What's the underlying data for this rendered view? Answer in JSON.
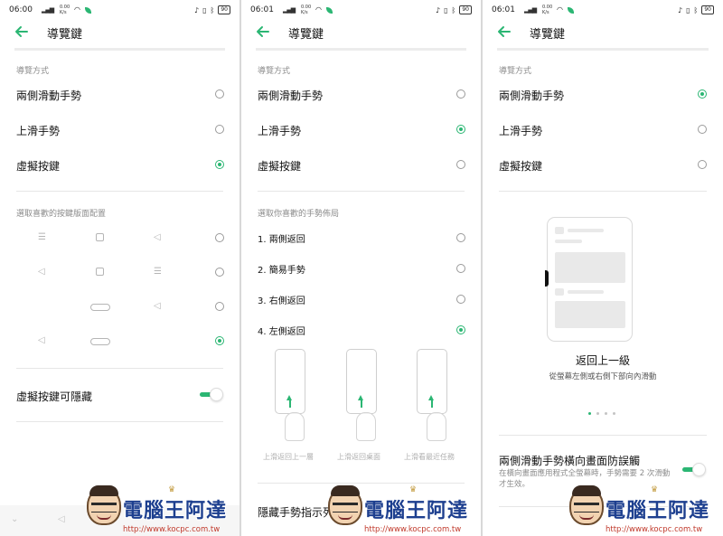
{
  "theme": {
    "accent": "#2bb673",
    "text": "#111111",
    "label": "#8c8c8c"
  },
  "panels": [
    {
      "status": {
        "time": "06:00",
        "speed_value": "0.00",
        "speed_unit": "K/s",
        "battery": "90"
      },
      "header": {
        "title": "導覽鍵",
        "back_icon": "back-arrow-icon"
      },
      "nav_mode_label": "導覽方式",
      "nav_modes": [
        {
          "label": "兩側滑動手勢",
          "selected": false
        },
        {
          "label": "上滑手勢",
          "selected": false
        },
        {
          "label": "虛擬按鍵",
          "selected": true
        }
      ],
      "layout_label": "選取喜歡的按鍵版面配置",
      "layouts": [
        {
          "keys": [
            "menu",
            "home-square",
            "back"
          ],
          "selected": false
        },
        {
          "keys": [
            "back",
            "home-square",
            "menu"
          ],
          "selected": false
        },
        {
          "keys": [
            "pill",
            "back"
          ],
          "selected": false
        },
        {
          "keys": [
            "back",
            "pill"
          ],
          "selected": true
        }
      ],
      "hide_toggle": {
        "label": "虛擬按鍵可隱藏",
        "on": true
      }
    },
    {
      "status": {
        "time": "06:01",
        "speed_value": "0.00",
        "speed_unit": "K/s",
        "battery": "90"
      },
      "header": {
        "title": "導覽鍵",
        "back_icon": "back-arrow-icon"
      },
      "nav_mode_label": "導覽方式",
      "nav_modes": [
        {
          "label": "兩側滑動手勢",
          "selected": false
        },
        {
          "label": "上滑手勢",
          "selected": true
        },
        {
          "label": "虛擬按鍵",
          "selected": false
        }
      ],
      "gesture_label": "選取你喜歡的手勢佈局",
      "gestures": [
        {
          "label": "1. 兩側返回",
          "selected": false
        },
        {
          "label": "2. 簡易手勢",
          "selected": false
        },
        {
          "label": "3. 右側返回",
          "selected": false
        },
        {
          "label": "4. 左側返回",
          "selected": true
        }
      ],
      "gesture_captions": [
        "上滑返回上一層",
        "上滑返回桌面",
        "上滑看最近任務"
      ],
      "hide_indicator": {
        "label": "隱藏手勢指示列"
      }
    },
    {
      "status": {
        "time": "06:01",
        "speed_value": "0.00",
        "speed_unit": "K/s",
        "battery": "90"
      },
      "header": {
        "title": "導覽鍵",
        "back_icon": "back-arrow-icon"
      },
      "nav_mode_label": "導覽方式",
      "nav_modes": [
        {
          "label": "兩側滑動手勢",
          "selected": true
        },
        {
          "label": "上滑手勢",
          "selected": false
        },
        {
          "label": "虛擬按鍵",
          "selected": false
        }
      ],
      "demo": {
        "title": "返回上一級",
        "subtitle": "從螢幕左側或右側下部向內滑動",
        "page_count": 4,
        "active_page": 0
      },
      "landscape": {
        "label": "兩側滑動手勢橫向畫面防誤觸",
        "description": "在橫向畫面應用程式全螢幕時，手勢需要 2 次滑動才生效。",
        "on": true
      }
    }
  ],
  "watermark": {
    "brand": "電腦王阿達",
    "url": "http://www.kocpc.com.tw"
  }
}
